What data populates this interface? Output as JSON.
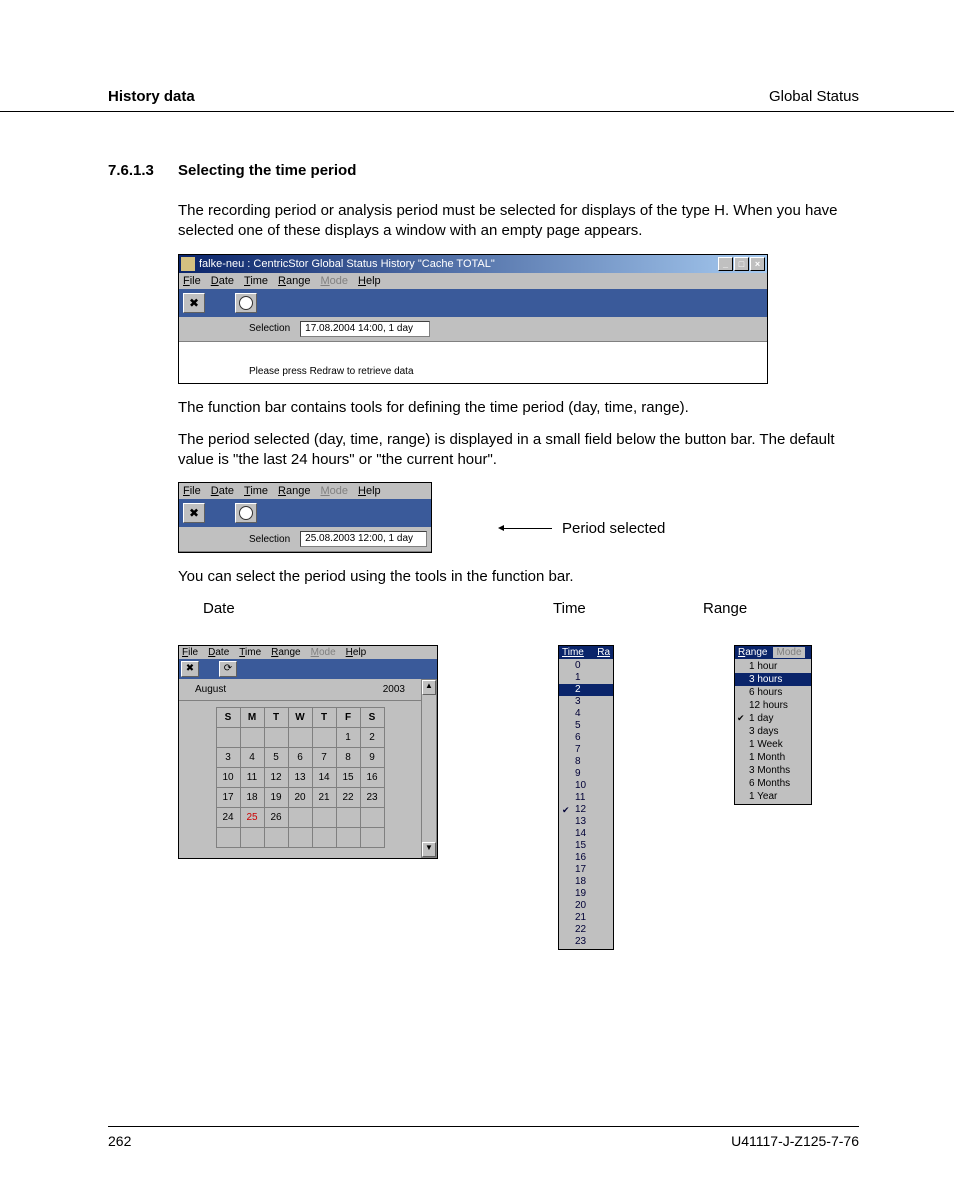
{
  "header": {
    "left": "History data",
    "right": "Global Status"
  },
  "section": {
    "number": "7.6.1.3",
    "title": "Selecting the time period"
  },
  "para1": "The recording period or analysis period must be selected for displays of the type H. When you have selected one of these displays a window with an empty page appears.",
  "win1": {
    "title": "falke-neu : CentricStor Global Status History \"Cache TOTAL\"",
    "menus": [
      "File",
      "Date",
      "Time",
      "Range",
      "Mode",
      "Help"
    ],
    "menus_disabled": [
      4
    ],
    "selection_label": "Selection",
    "selection_value": "17.08.2004 14:00, 1 day",
    "body_text": "Please press Redraw to retrieve data"
  },
  "para2": "The function bar contains tools for defining the time period (day, time, range).",
  "para3": "The period selected (day, time, range) is displayed in a small field below the button bar. The default value is \"the last 24 hours\" or \"the current hour\".",
  "win2": {
    "menus": [
      "File",
      "Date",
      "Time",
      "Range",
      "Mode",
      "Help"
    ],
    "menus_disabled": [
      4
    ],
    "selection_label": "Selection",
    "selection_value": "25.08.2003 12:00, 1 day",
    "annotation": "Period selected"
  },
  "para4": "You can select the period using the tools in the function bar.",
  "tool_labels": {
    "date": "Date",
    "time": "Time",
    "range": "Range"
  },
  "calendar": {
    "topbar_menus": [
      "File",
      "Date",
      "Time",
      "Range",
      "Mode",
      "Help"
    ],
    "topbar_disabled": [
      4
    ],
    "month": "August",
    "year": "2003",
    "weekdays": [
      "S",
      "M",
      "T",
      "W",
      "T",
      "F",
      "S"
    ],
    "rows": [
      [
        "",
        "",
        "",
        "",
        "",
        "1",
        "2"
      ],
      [
        "3",
        "4",
        "5",
        "6",
        "7",
        "8",
        "9"
      ],
      [
        "10",
        "11",
        "12",
        "13",
        "14",
        "15",
        "16"
      ],
      [
        "17",
        "18",
        "19",
        "20",
        "21",
        "22",
        "23"
      ],
      [
        "24",
        "25",
        "26",
        "",
        "",
        "",
        ""
      ],
      [
        "",
        "",
        "",
        "",
        "",
        "",
        ""
      ]
    ],
    "today": "25"
  },
  "time_panel": {
    "head_a": "Time",
    "head_b": "Ra",
    "items": [
      "0",
      "1",
      "2",
      "3",
      "4",
      "5",
      "6",
      "7",
      "8",
      "9",
      "10",
      "11",
      "12",
      "13",
      "14",
      "15",
      "16",
      "17",
      "18",
      "19",
      "20",
      "21",
      "22",
      "23"
    ],
    "selected_index": 2,
    "checked_index": 12
  },
  "range_panel": {
    "head_a": "Range",
    "head_b": "Mode",
    "items": [
      "1 hour",
      "3 hours",
      "6 hours",
      "12 hours",
      "1 day",
      "3 days",
      "1 Week",
      "1 Month",
      "3 Months",
      "6 Months",
      "1 Year"
    ],
    "selected_index": 1,
    "checked_index": 4
  },
  "footer": {
    "page": "262",
    "doc_id": "U41117-J-Z125-7-76"
  }
}
